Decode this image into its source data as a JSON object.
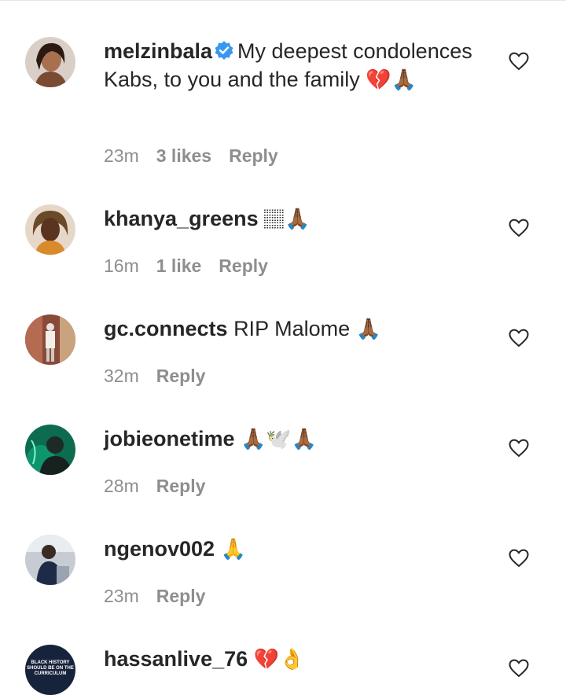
{
  "comments": [
    {
      "username": "melzinbala",
      "verified": true,
      "text": "My deepest condolences Kabs, to you and the family",
      "emojis": "💔🙏🏾",
      "time": "23m",
      "likes": "3 likes",
      "reply": "Reply"
    },
    {
      "username": "khanya_greens",
      "text": "",
      "emojis": "🏽🙏🏾",
      "time": "16m",
      "likes": "1 like",
      "reply": "Reply"
    },
    {
      "username": "gc.connects",
      "text": "RIP Malome",
      "emojis": "🙏🏾",
      "time": "32m",
      "reply": "Reply"
    },
    {
      "username": "jobieonetime",
      "text": "",
      "emojis": "🙏🏾🕊️🙏🏾",
      "time": "28m",
      "reply": "Reply"
    },
    {
      "username": "ngenov002",
      "text": "",
      "emojis": "🙏",
      "time": "23m",
      "reply": "Reply"
    },
    {
      "username": "hassanlive_76",
      "text": "",
      "emojis": "💔👌",
      "avatar_text": "BLACK HISTORY SHOULD BE ON THE CURRICULUM"
    }
  ],
  "icons": {
    "like": "heart-outline-icon",
    "verified": "verified-badge-icon"
  },
  "colors": {
    "text": "#262626",
    "secondary": "#8e8e8e",
    "verified": "#3897f0"
  }
}
